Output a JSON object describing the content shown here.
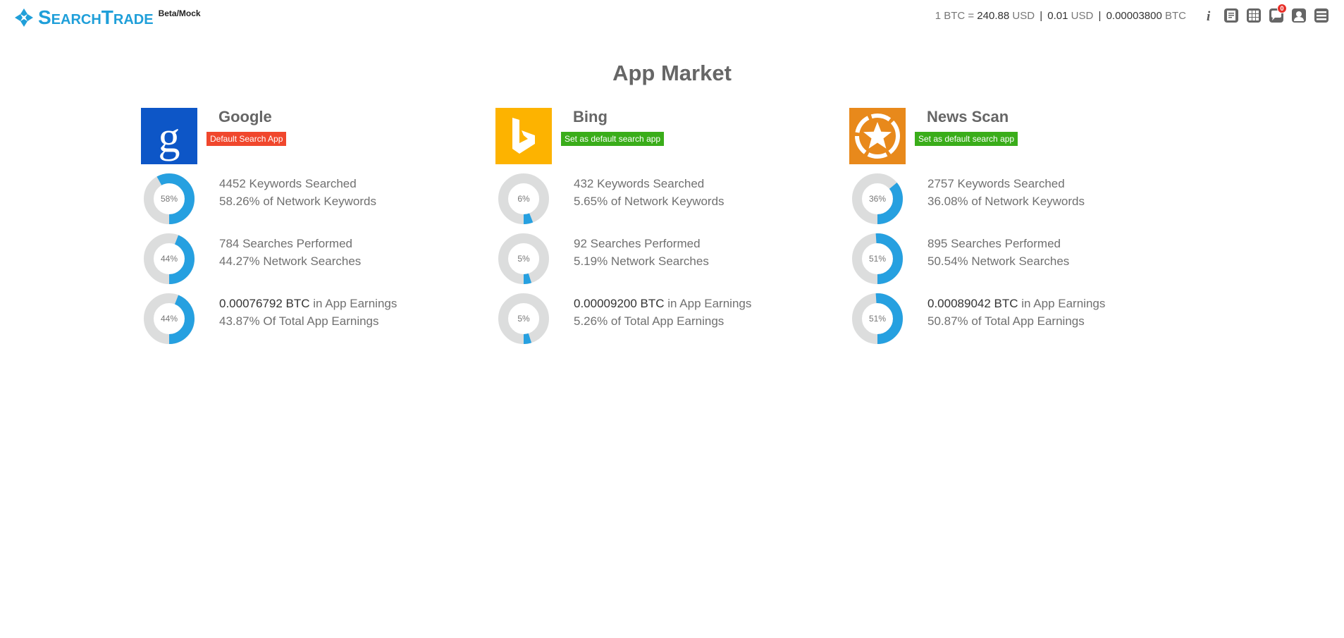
{
  "brand": {
    "name": "SearchTrade",
    "beta": "Beta/Mock",
    "color": "#1f9fd9"
  },
  "header": {
    "rate_prefix": "1 BTC =",
    "rate_usd_value": "240.88",
    "rate_usd_unit": "USD",
    "sep": "|",
    "usd_value": "0.01",
    "usd_unit": "USD",
    "btc_value": "0.00003800",
    "btc_unit": "BTC",
    "notification_count": "0",
    "icons": [
      "info-icon",
      "receipt-icon",
      "grid-icon",
      "chat-icon",
      "user-icon",
      "menu-icon"
    ]
  },
  "page": {
    "title": "App Market"
  },
  "apps": [
    {
      "name": "Google",
      "badge": "Default Search App",
      "badge_type": "default",
      "logo_color": "#0d56c7",
      "stats": [
        {
          "percent": 58,
          "label": "58%",
          "line1_strong": "",
          "line1": "4452 Keywords Searched",
          "line2": "58.26% of Network Keywords"
        },
        {
          "percent": 44,
          "label": "44%",
          "line1_strong": "",
          "line1": "784 Searches Performed",
          "line2": "44.27% Network Searches"
        },
        {
          "percent": 44,
          "label": "44%",
          "line1_strong": "0.00076792 BTC",
          "line1": " in App Earnings",
          "line2": "43.87% Of Total App Earnings"
        }
      ]
    },
    {
      "name": "Bing",
      "badge": "Set as default search app",
      "badge_type": "setdefault",
      "logo_color": "#fdb300",
      "stats": [
        {
          "percent": 6,
          "label": "6%",
          "line1_strong": "",
          "line1": "432 Keywords Searched",
          "line2": "5.65% of Network Keywords"
        },
        {
          "percent": 5,
          "label": "5%",
          "line1_strong": "",
          "line1": "92 Searches Performed",
          "line2": "5.19% Network Searches"
        },
        {
          "percent": 5,
          "label": "5%",
          "line1_strong": "0.00009200 BTC",
          "line1": " in App Earnings",
          "line2": "5.26% of Total App Earnings"
        }
      ]
    },
    {
      "name": "News Scan",
      "badge": "Set as default search app",
      "badge_type": "setdefault",
      "logo_color": "#e8891b",
      "stats": [
        {
          "percent": 36,
          "label": "36%",
          "line1_strong": "",
          "line1": "2757 Keywords Searched",
          "line2": "36.08% of Network Keywords"
        },
        {
          "percent": 51,
          "label": "51%",
          "line1_strong": "",
          "line1": "895 Searches Performed",
          "line2": "50.54% Network Searches"
        },
        {
          "percent": 51,
          "label": "51%",
          "line1_strong": "0.00089042 BTC",
          "line1": " in App Earnings",
          "line2": "50.87% of Total App Earnings"
        }
      ]
    }
  ],
  "colors": {
    "donut_fill": "#26a0e0",
    "donut_track": "#dcdddd"
  }
}
